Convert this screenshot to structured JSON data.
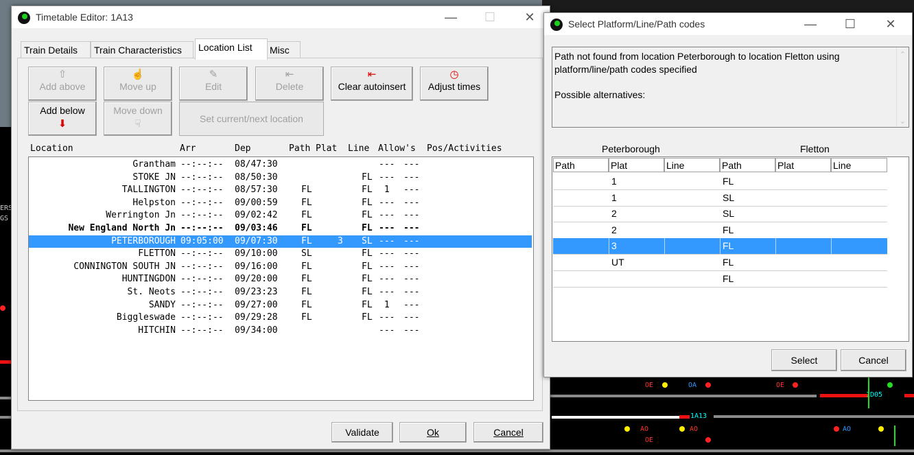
{
  "background": {
    "train_labels": [
      {
        "text": "1A13",
        "color": "#00ffff"
      },
      {
        "text": "1D05",
        "color": "#00ffff"
      }
    ],
    "misc_labels": [
      "AO",
      "AO",
      "AO",
      "AO",
      "OE",
      "OE",
      "OE",
      "OA",
      "ERS",
      "GS"
    ]
  },
  "editor": {
    "title": "Timetable Editor: 1A13",
    "tabs": [
      "Train Details",
      "Train Characteristics",
      "Location List",
      "Misc"
    ],
    "active_tab": "Location List",
    "buttons": {
      "add_above": "Add above",
      "move_up": "Move up",
      "edit": "Edit",
      "delete": "Delete",
      "clear_autoinsert": "Clear autoinsert",
      "adjust_times": "Adjust times",
      "add_below": "Add below",
      "move_down": "Move down",
      "set_current_next": "Set current/next location"
    },
    "columns": {
      "location": "Location",
      "arr": "Arr",
      "dep": "Dep",
      "path": "Path",
      "plat": "Plat",
      "line": "Line",
      "allows": "Allow's",
      "pos": "Pos/Activities"
    },
    "rows": [
      {
        "location": "Grantham",
        "arr": "--:--:--",
        "dep": "08/47:30",
        "path": "",
        "plat": "",
        "line": "",
        "allow": "---",
        "pos": "---"
      },
      {
        "location": "STOKE JN",
        "arr": "--:--:--",
        "dep": "08/50:30",
        "path": "",
        "plat": "",
        "line": "FL",
        "allow": "---",
        "pos": "---"
      },
      {
        "location": "TALLINGTON",
        "arr": "--:--:--",
        "dep": "08/57:30",
        "path": "FL",
        "plat": "",
        "line": "FL",
        "allow": " 1 ",
        "pos": "---"
      },
      {
        "location": "Helpston",
        "arr": "--:--:--",
        "dep": "09/00:59",
        "path": "FL",
        "plat": "",
        "line": "FL",
        "allow": "---",
        "pos": "---"
      },
      {
        "location": "Werrington Jn",
        "arr": "--:--:--",
        "dep": "09/02:42",
        "path": "FL",
        "plat": "",
        "line": "FL",
        "allow": "---",
        "pos": "---"
      },
      {
        "location": "New England North Jn",
        "arr": "--:--:--",
        "dep": "09/03:46",
        "path": "FL",
        "plat": "",
        "line": "FL",
        "allow": "---",
        "pos": "---",
        "bold": true
      },
      {
        "location": "PETERBOROUGH",
        "arr": "09:05:00",
        "dep": "09/07:30",
        "path": "FL",
        "plat": "3",
        "line": "SL",
        "allow": "---",
        "pos": "---",
        "selected": true
      },
      {
        "location": "FLETTON",
        "arr": "--:--:--",
        "dep": "09/10:00",
        "path": "SL",
        "plat": "",
        "line": "FL",
        "allow": "---",
        "pos": "---"
      },
      {
        "location": "CONNINGTON SOUTH JN",
        "arr": "--:--:--",
        "dep": "09/16:00",
        "path": "FL",
        "plat": "",
        "line": "FL",
        "allow": "---",
        "pos": "---"
      },
      {
        "location": "HUNTINGDON",
        "arr": "--:--:--",
        "dep": "09/20:00",
        "path": "FL",
        "plat": "",
        "line": "FL",
        "allow": "---",
        "pos": "---"
      },
      {
        "location": "St. Neots",
        "arr": "--:--:--",
        "dep": "09/23:23",
        "path": "FL",
        "plat": "",
        "line": "FL",
        "allow": "---",
        "pos": "---"
      },
      {
        "location": "SANDY",
        "arr": "--:--:--",
        "dep": "09/27:00",
        "path": "FL",
        "plat": "",
        "line": "FL",
        "allow": " 1 ",
        "pos": "---"
      },
      {
        "location": "Biggleswade",
        "arr": "--:--:--",
        "dep": "09/29:28",
        "path": "FL",
        "plat": "",
        "line": "FL",
        "allow": "---",
        "pos": "---"
      },
      {
        "location": "HITCHIN",
        "arr": "--:--:--",
        "dep": "09/34:00",
        "path": "",
        "plat": "",
        "line": "",
        "allow": "---",
        "pos": "---"
      }
    ],
    "footer": {
      "validate": "Validate",
      "ok": "Ok",
      "cancel": "Cancel"
    }
  },
  "dialog": {
    "title": "Select Platform/Line/Path codes",
    "message_line1": "Path not found from location Peterborough to location Fletton using",
    "message_line2": "platform/line/path codes specified",
    "message_line3": "Possible alternatives:",
    "from_location": "Peterborough",
    "to_location": "Fletton",
    "headers": [
      "Path",
      "Plat",
      "Line",
      "Path",
      "Plat",
      "Line"
    ],
    "rows": [
      [
        "",
        "1",
        "",
        "FL",
        "",
        ""
      ],
      [
        "",
        "1",
        "",
        "SL",
        "",
        ""
      ],
      [
        "",
        "2",
        "",
        "SL",
        "",
        ""
      ],
      [
        "",
        "2",
        "",
        "FL",
        "",
        ""
      ],
      [
        "",
        "3",
        "",
        "FL",
        "",
        ""
      ],
      [
        "",
        "UT",
        "",
        "FL",
        "",
        ""
      ],
      [
        "",
        "",
        "",
        "FL",
        "",
        ""
      ]
    ],
    "selected_row": 4,
    "buttons": {
      "select": "Select",
      "cancel": "Cancel"
    }
  }
}
